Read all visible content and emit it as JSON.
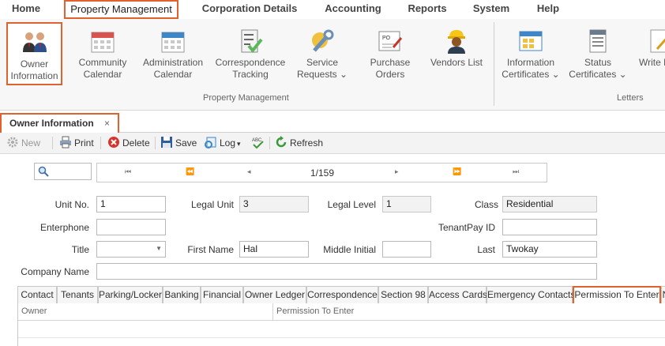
{
  "menu": {
    "items": [
      "Home",
      "Property Management",
      "Corporation Details",
      "Accounting",
      "Reports",
      "System",
      "Help"
    ]
  },
  "ribbon": {
    "buttons": [
      {
        "line1": "Owner",
        "line2": "Information",
        "icon": "owners-icon"
      },
      {
        "line1": "Community",
        "line2": "Calendar",
        "icon": "calendar-icon"
      },
      {
        "line1": "Administration",
        "line2": "Calendar",
        "icon": "calendar-icon"
      },
      {
        "line1": "Correspondence",
        "line2": "Tracking",
        "icon": "checklist-icon"
      },
      {
        "line1": "Service",
        "line2": "Requests ⌄",
        "icon": "wrench-icon"
      },
      {
        "line1": "Purchase",
        "line2": "Orders",
        "icon": "purchase-order-icon"
      },
      {
        "line1": "Vendors List",
        "line2": "",
        "icon": "worker-icon"
      },
      {
        "line1": "Information",
        "line2": "Certificates ⌄",
        "icon": "info-certificate-icon"
      },
      {
        "line1": "Status",
        "line2": "Certificates ⌄",
        "icon": "status-certificate-icon"
      },
      {
        "line1": "Write L",
        "line2": "",
        "icon": "write-letter-icon"
      }
    ],
    "group1_label": "Property Management",
    "group2_label": "Letters"
  },
  "doctab": {
    "label": "Owner Information",
    "close": "×"
  },
  "toolbar": {
    "new": "New",
    "print": "Print",
    "delete": "Delete",
    "save": "Save",
    "log": "Log",
    "log_caret": "▾",
    "refresh": "Refresh"
  },
  "navigator": {
    "first": "⏮",
    "prev_page": "⏪",
    "prev": "◂",
    "position": "1/159",
    "next": "▸",
    "next_page": "⏩",
    "last": "⏭"
  },
  "form": {
    "unit_no_label": "Unit No.",
    "unit_no": "1",
    "legal_unit_label": "Legal Unit",
    "legal_unit": "3",
    "legal_level_label": "Legal Level",
    "legal_level": "1",
    "class_label": "Class",
    "class_value": "Residential",
    "enterphone_label": "Enterphone",
    "enterphone": "",
    "tenantpay_label": "TenantPay ID",
    "tenantpay": "",
    "title_label": "Title",
    "title": "",
    "first_name_label": "First Name",
    "first_name": "Hal",
    "middle_initial_label": "Middle Initial",
    "middle_initial": "",
    "last_label": "Last",
    "last": "Twokay",
    "company_label": "Company Name",
    "company": ""
  },
  "tabs": [
    "Contact",
    "Tenants",
    "Parking/Locker",
    "Banking",
    "Financial",
    "Owner Ledger",
    "Correspondence",
    "Section 98",
    "Access Cards",
    "Emergency Contacts",
    "Permission To Enter",
    "N"
  ],
  "grid": {
    "columns": [
      "Owner",
      "Permission To Enter"
    ]
  },
  "colors": {
    "highlight": "#e0632f"
  }
}
